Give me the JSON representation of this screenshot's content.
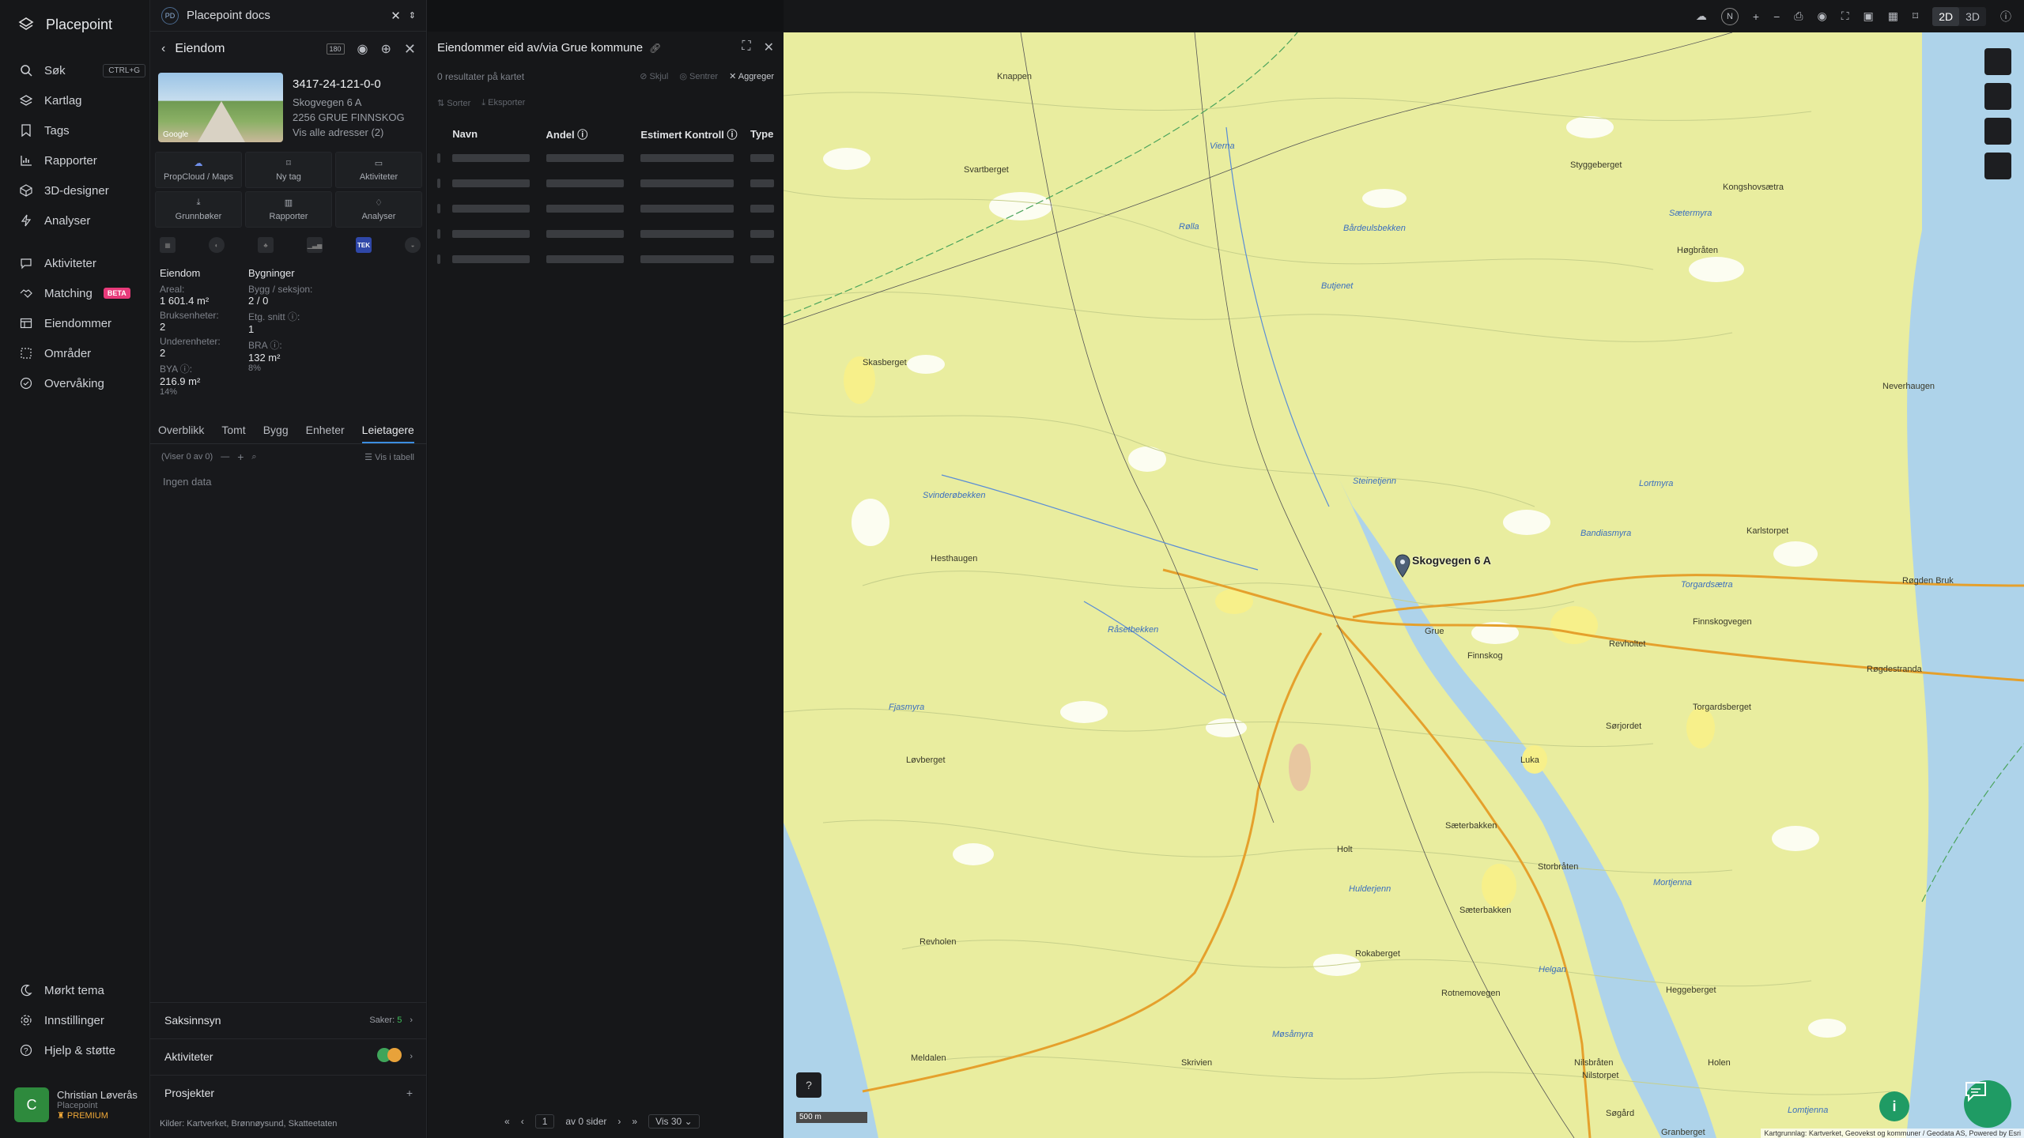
{
  "app": {
    "brand": "Placepoint",
    "nav": [
      {
        "label": "Søk",
        "icon": "search-icon",
        "shortcut": "CTRL+G"
      },
      {
        "label": "Kartlag",
        "icon": "layers-icon"
      },
      {
        "label": "Tags",
        "icon": "bookmark-icon"
      },
      {
        "label": "Rapporter",
        "icon": "chart-icon"
      },
      {
        "label": "3D-designer",
        "icon": "cube-icon"
      },
      {
        "label": "Analyser",
        "icon": "bolt-icon"
      },
      {
        "label": "Aktiviteter",
        "icon": "chat-icon"
      },
      {
        "label": "Matching",
        "icon": "handshake-icon",
        "badge": "BETA"
      },
      {
        "label": "Eiendommer",
        "icon": "table-icon"
      },
      {
        "label": "Områder",
        "icon": "area-icon"
      },
      {
        "label": "Overvåking",
        "icon": "monitor-icon"
      }
    ],
    "bottom_nav": [
      {
        "label": "Mørkt tema",
        "icon": "moon-icon"
      },
      {
        "label": "Innstillinger",
        "icon": "gear-icon"
      },
      {
        "label": "Hjelp & støtte",
        "icon": "help-icon"
      }
    ],
    "user": {
      "initial": "C",
      "name": "Christian Løverås",
      "org": "Placepoint",
      "plan": "PREMIUM"
    }
  },
  "panel": {
    "docs_badge": "PD",
    "docs_title": "Placepoint docs",
    "title": "Eiendom",
    "header_badge": "180",
    "property": {
      "id": "3417-24-121-0-0",
      "address": "Skogvegen 6 A",
      "postal": "2256 GRUE FINNSKOG",
      "all_addresses": "Vis alle adresser (2)",
      "thumb_label": "Google"
    },
    "actions": [
      {
        "label": "PropCloud / Maps"
      },
      {
        "label": "Ny tag"
      },
      {
        "label": "Aktiviteter"
      },
      {
        "label": "Grunnbøker"
      },
      {
        "label": "Rapporter"
      },
      {
        "label": "Analyser"
      }
    ],
    "mini_icons": [
      "",
      "",
      "",
      "",
      "TEK",
      ""
    ],
    "facts": {
      "col1_title": "Eiendom",
      "col2_title": "Bygninger",
      "areal_label": "Areal:",
      "areal_value": "1 601.4 m²",
      "bygg_label": "Bygg / seksjon:",
      "bygg_value": "2 / 0",
      "bruks_label": "Bruksenheter:",
      "bruks_value": "2",
      "etg_label": "Etg. snitt ⓘ:",
      "etg_value": "1",
      "under_label": "Underenheter:",
      "under_value": "2",
      "bra_label": "BRA ⓘ:",
      "bra_value": "132 m²",
      "bra_pct": "8%",
      "bya_label": "BYA ⓘ:",
      "bya_value": "216.9 m²",
      "bya_pct": "14%"
    },
    "tabs": [
      "Overblikk",
      "Tomt",
      "Bygg",
      "Enheter",
      "Leietagere"
    ],
    "active_tab": 4,
    "viser": "(Viser 0 av 0)",
    "vis_tabell": "Vis i tabell",
    "no_data": "Ingen data",
    "sections": {
      "saksinnsyn": "Saksinnsyn",
      "saker_label": "Saker:",
      "saker_value": "5",
      "aktiviteter": "Aktiviteter",
      "prosjekter": "Prosjekter"
    },
    "kilder_label": "Kilder:",
    "kilder": [
      "Kartverket,",
      "Brønnøysund,",
      "Skatteetaten"
    ]
  },
  "list": {
    "title": "Eiendommer eid av/via Grue kommune",
    "count": "0 resultater på kartet",
    "skjul": "Skjul",
    "sentrer": "Sentrer",
    "aggreger": "Aggreger",
    "sorter": "Sorter",
    "eksporter": "Eksporter",
    "columns": [
      "Navn",
      "Andel ⓘ",
      "Estimert Kontroll ⓘ",
      "Type"
    ],
    "skeleton_rows": 5,
    "pager": {
      "page": "1",
      "of_label": "av 0 sider",
      "vis": "Vis 30"
    }
  },
  "map": {
    "toolbar": {
      "compass": "N",
      "mode_2d": "2D",
      "mode_3d": "3D"
    },
    "scale": "500 m",
    "marker_label": "Skogvegen 6 A",
    "attribution": "Kartgrunnlag: Kartverket, Geovekst og kommuner / Geodata AS, Powered by Esri",
    "labels": [
      {
        "t": "Knappen",
        "w": false
      },
      {
        "t": "Svartberget",
        "w": false
      },
      {
        "t": "Styggeberget",
        "w": false
      },
      {
        "t": "Kongshovsætra",
        "w": false
      },
      {
        "t": "Høgbråten",
        "w": false
      },
      {
        "t": "Skasberget",
        "w": false
      },
      {
        "t": "Neverhaugen",
        "w": false
      },
      {
        "t": "Hesthaugen",
        "w": false
      },
      {
        "t": "Karlstorpet",
        "w": false
      },
      {
        "t": "Røgden Bruk",
        "w": false
      },
      {
        "t": "Grue",
        "w": false
      },
      {
        "t": "Finnskog",
        "w": false
      },
      {
        "t": "Revholtet",
        "w": false
      },
      {
        "t": "Torgardsberget",
        "w": false
      },
      {
        "t": "Løvberget",
        "w": false
      },
      {
        "t": "Luka",
        "w": false
      },
      {
        "t": "Sørjordet",
        "w": false
      },
      {
        "t": "Sæterbakken",
        "w": false
      },
      {
        "t": "Holt",
        "w": false
      },
      {
        "t": "Storbråten",
        "w": false
      },
      {
        "t": "Sæterbakken",
        "w": false
      },
      {
        "t": "Revholen",
        "w": false
      },
      {
        "t": "Rokaberget",
        "w": false
      },
      {
        "t": "Heggeberget",
        "w": false
      },
      {
        "t": "Meldalen",
        "w": false
      },
      {
        "t": "Skrivien",
        "w": false
      },
      {
        "t": "Nilsbråten",
        "w": false
      },
      {
        "t": "Nilstorpet",
        "w": false
      },
      {
        "t": "Holen",
        "w": false
      },
      {
        "t": "Søgård",
        "w": false
      },
      {
        "t": "Granberget",
        "w": false
      },
      {
        "t": "Finnskogvegen",
        "w": false
      },
      {
        "t": "Røgdestranda",
        "w": false
      },
      {
        "t": "Rotnemovegen",
        "w": false
      },
      {
        "t": "Vierna",
        "w": true
      },
      {
        "t": "Bårdeulsbekken",
        "w": true
      },
      {
        "t": "Sætermyra",
        "w": true
      },
      {
        "t": "Butjenet",
        "w": true
      },
      {
        "t": "Steinetjenn",
        "w": true
      },
      {
        "t": "Lortmyra",
        "w": true
      },
      {
        "t": "Bandiasmyra",
        "w": true
      },
      {
        "t": "Torgardsætra",
        "w": true
      },
      {
        "t": "Svinderøbekken",
        "w": true
      },
      {
        "t": "Fjasmyra",
        "w": true
      },
      {
        "t": "Hulderjenn",
        "w": true
      },
      {
        "t": "Mortjenna",
        "w": true
      },
      {
        "t": "Helgan",
        "w": true
      },
      {
        "t": "Møsåmyra",
        "w": true
      },
      {
        "t": "Lomtjenna",
        "w": true
      },
      {
        "t": "Rølla",
        "w": true
      },
      {
        "t": "Råsetbekken",
        "w": true
      }
    ]
  }
}
